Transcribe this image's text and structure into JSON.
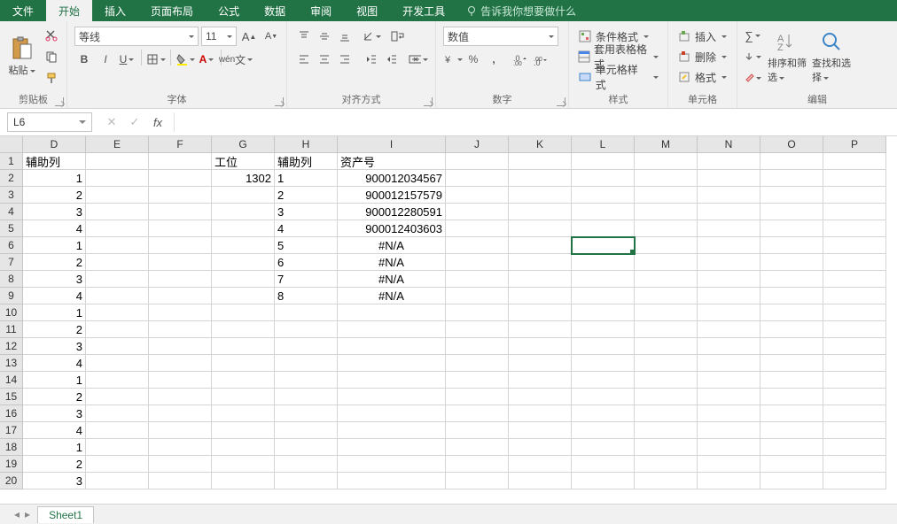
{
  "tabs": {
    "items": [
      "文件",
      "开始",
      "插入",
      "页面布局",
      "公式",
      "数据",
      "审阅",
      "视图",
      "开发工具"
    ],
    "active_index": 1,
    "tell_me": "告诉我你想要做什么"
  },
  "ribbon": {
    "clipboard": {
      "paste": "粘贴",
      "label": "剪贴板"
    },
    "font": {
      "name": "等线",
      "size": "11",
      "label": "字体"
    },
    "alignment": {
      "label": "对齐方式"
    },
    "number": {
      "format": "数值",
      "label": "数字"
    },
    "styles": {
      "conditional": "条件格式",
      "table": "套用表格格式",
      "cell": "单元格样式",
      "label": "样式"
    },
    "cells": {
      "insert": "插入",
      "delete": "删除",
      "format": "格式",
      "label": "单元格"
    },
    "editing": {
      "sort": "排序和筛选",
      "find": "查找和选择",
      "label": "编辑"
    }
  },
  "formula_bar": {
    "name_box": "L6",
    "fx": "fx",
    "formula": ""
  },
  "grid": {
    "selected_cell": "L6",
    "col_widths": {
      "rowhdr": 26,
      "D": 71,
      "E": 71,
      "F": 71,
      "G": 71,
      "H": 71,
      "I": 122,
      "J": 71,
      "K": 71,
      "L": 71,
      "M": 71,
      "N": 71,
      "O": 71,
      "P": 71
    },
    "columns": [
      "D",
      "E",
      "F",
      "G",
      "H",
      "I",
      "J",
      "K",
      "L",
      "M",
      "N",
      "O",
      "P"
    ],
    "rows": 20,
    "data": {
      "1": {
        "D": {
          "v": "辅助列",
          "a": "left"
        },
        "G": {
          "v": "工位",
          "a": "left"
        },
        "H": {
          "v": "辅助列",
          "a": "left"
        },
        "I": {
          "v": "资产号",
          "a": "left"
        }
      },
      "2": {
        "D": {
          "v": "1",
          "a": "right"
        },
        "G": {
          "v": "1302",
          "a": "right"
        },
        "H": {
          "v": "1",
          "a": "left"
        },
        "I": {
          "v": "900012034567",
          "a": "right"
        }
      },
      "3": {
        "D": {
          "v": "2",
          "a": "right"
        },
        "H": {
          "v": "2",
          "a": "left"
        },
        "I": {
          "v": "900012157579",
          "a": "right"
        }
      },
      "4": {
        "D": {
          "v": "3",
          "a": "right"
        },
        "H": {
          "v": "3",
          "a": "left"
        },
        "I": {
          "v": "900012280591",
          "a": "right"
        }
      },
      "5": {
        "D": {
          "v": "4",
          "a": "right"
        },
        "H": {
          "v": "4",
          "a": "left"
        },
        "I": {
          "v": "900012403603",
          "a": "right"
        }
      },
      "6": {
        "D": {
          "v": "1",
          "a": "right"
        },
        "H": {
          "v": "5",
          "a": "left"
        },
        "I": {
          "v": "#N/A",
          "a": "center"
        }
      },
      "7": {
        "D": {
          "v": "2",
          "a": "right"
        },
        "H": {
          "v": "6",
          "a": "left"
        },
        "I": {
          "v": "#N/A",
          "a": "center"
        }
      },
      "8": {
        "D": {
          "v": "3",
          "a": "right"
        },
        "H": {
          "v": "7",
          "a": "left"
        },
        "I": {
          "v": "#N/A",
          "a": "center"
        }
      },
      "9": {
        "D": {
          "v": "4",
          "a": "right"
        },
        "H": {
          "v": "8",
          "a": "left"
        },
        "I": {
          "v": "#N/A",
          "a": "center"
        }
      },
      "10": {
        "D": {
          "v": "1",
          "a": "right"
        }
      },
      "11": {
        "D": {
          "v": "2",
          "a": "right"
        }
      },
      "12": {
        "D": {
          "v": "3",
          "a": "right"
        }
      },
      "13": {
        "D": {
          "v": "4",
          "a": "right"
        }
      },
      "14": {
        "D": {
          "v": "1",
          "a": "right"
        }
      },
      "15": {
        "D": {
          "v": "2",
          "a": "right"
        }
      },
      "16": {
        "D": {
          "v": "3",
          "a": "right"
        }
      },
      "17": {
        "D": {
          "v": "4",
          "a": "right"
        }
      },
      "18": {
        "D": {
          "v": "1",
          "a": "right"
        }
      },
      "19": {
        "D": {
          "v": "2",
          "a": "right"
        }
      },
      "20": {
        "D": {
          "v": "3",
          "a": "right"
        }
      }
    }
  },
  "footer": {
    "sheet_name": "Sheet1"
  }
}
